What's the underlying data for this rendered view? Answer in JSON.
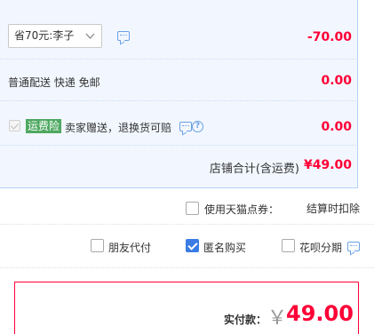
{
  "coupon": {
    "selected": "省70元:李子",
    "amount": "-70.00"
  },
  "shipping": {
    "label": "普通配送 快递 免邮",
    "amount": "0.00"
  },
  "insurance": {
    "badge": "运费险",
    "text": "卖家赠送，退换货可赔",
    "amount": "0.00",
    "help_glyph": "?"
  },
  "subtotal": {
    "label": "店铺合计(含运费)",
    "value": "¥49.00"
  },
  "points": {
    "label": "使用天猫点券：",
    "note": "结算时扣除"
  },
  "payment_options": {
    "friend_pay": "朋友代付",
    "anonymous": "匿名购买",
    "installment": "花呗分期",
    "anonymous_checked": true
  },
  "total": {
    "label": "实付款：",
    "currency": "￥",
    "amount": "49.00"
  },
  "colors": {
    "accent_red": "#ff0036",
    "panel_bg": "#f2f7ff",
    "checkbox_blue": "#3a7be4",
    "badge_green": "#4ea861"
  }
}
